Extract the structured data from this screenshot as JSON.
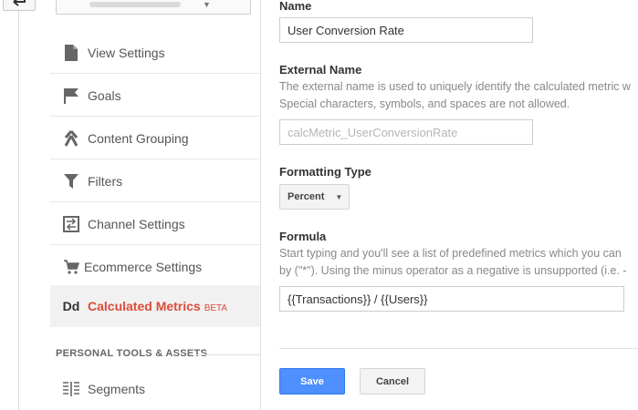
{
  "sidebar": {
    "items": [
      {
        "label": "View Settings",
        "icon": "document-icon"
      },
      {
        "label": "Goals",
        "icon": "flag-icon"
      },
      {
        "label": "Content Grouping",
        "icon": "grouping-icon"
      },
      {
        "label": "Filters",
        "icon": "filter-icon"
      },
      {
        "label": "Channel Settings",
        "icon": "channel-settings-icon"
      },
      {
        "label": "Ecommerce Settings",
        "icon": "cart-icon"
      },
      {
        "label": "Calculated Metrics",
        "badge": "BETA",
        "icon_text": "Dd",
        "active": true
      }
    ],
    "section_header": "PERSONAL TOOLS & ASSETS",
    "section_items": [
      {
        "label": "Segments",
        "icon": "segments-icon"
      }
    ]
  },
  "form": {
    "name": {
      "label": "Name",
      "value": "User Conversion Rate"
    },
    "external_name": {
      "label": "External Name",
      "help_line1": "The external name is used to uniquely identify the calculated metric w",
      "help_line2": "Special characters, symbols, and spaces are not allowed.",
      "placeholder": "calcMetric_UserConversionRate"
    },
    "formatting_type": {
      "label": "Formatting Type",
      "value": "Percent"
    },
    "formula": {
      "label": "Formula",
      "help_line1": "Start typing and you'll see a list of predefined metrics which you can",
      "help_line2": "by (\"*\"). Using the minus operator as a negative is unsupported (i.e. -",
      "value": "{{Transactions}} / {{Users}}"
    },
    "save_label": "Save",
    "cancel_label": "Cancel"
  },
  "colors": {
    "accent_red": "#dd4b39",
    "primary_blue": "#4d90fe"
  }
}
